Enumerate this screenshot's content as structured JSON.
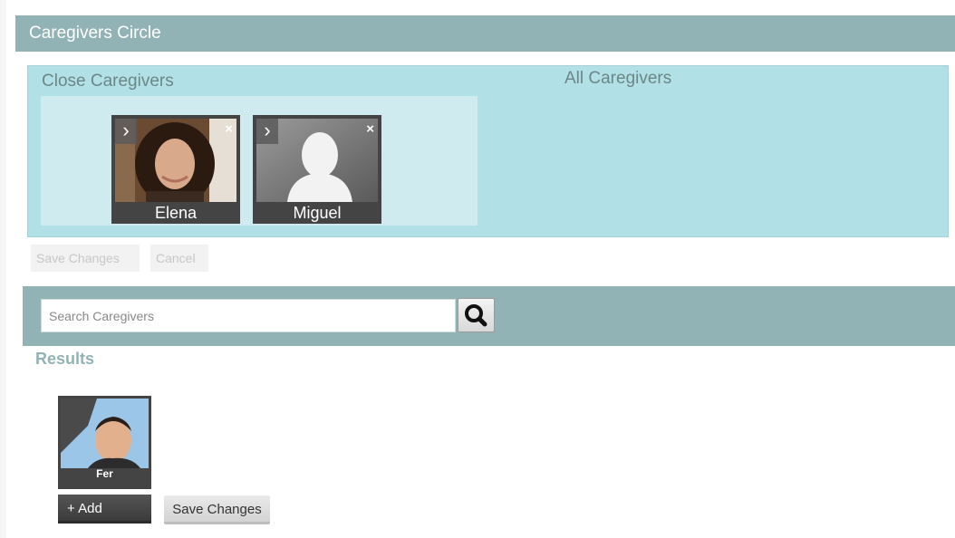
{
  "circle": {
    "header_title": "Caregivers Circle",
    "close_title": "Close Caregivers",
    "all_title": "All Caregivers",
    "close_caregivers": [
      {
        "name": "Elena",
        "expand_icon": "chevron-right-icon",
        "remove_icon": "close-icon"
      },
      {
        "name": "Miguel",
        "expand_icon": "chevron-right-icon",
        "remove_icon": "close-icon"
      }
    ],
    "save_label": "Save Changes",
    "cancel_label": "Cancel"
  },
  "search": {
    "placeholder": "Search Caregivers",
    "button_icon": "search-icon"
  },
  "results": {
    "title": "Results",
    "items": [
      {
        "name": "Fer"
      }
    ],
    "add_label": "+ Add",
    "save_label": "Save Changes"
  },
  "colors": {
    "header_bg": "#92b3b6",
    "panel_bg": "#b1e0e6",
    "close_box_bg": "#d0ebef",
    "card_bg": "#444444"
  }
}
